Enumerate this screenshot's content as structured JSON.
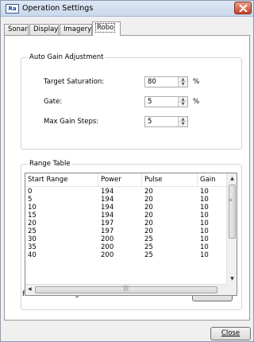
{
  "window": {
    "app_icon_text": "Ra",
    "title": "Operation Settings",
    "close_icon": "close-icon"
  },
  "tabs": [
    {
      "label": "Sonar"
    },
    {
      "label": "Display"
    },
    {
      "label": "Imagery"
    },
    {
      "label": "Robo",
      "active": true
    }
  ],
  "auto_gain": {
    "group_title": "Auto Gain Adjustment",
    "fields": [
      {
        "label": "Target Saturation:",
        "value": "80",
        "unit": "%"
      },
      {
        "label": "Gate:",
        "value": "5",
        "unit": "%"
      },
      {
        "label": "Max Gain Steps:",
        "value": "5",
        "unit": ""
      }
    ]
  },
  "range_table": {
    "group_title": "Range Table",
    "columns": [
      "Start Range",
      "Power",
      "Pulse",
      "Gain"
    ],
    "rows": [
      [
        "0",
        "194",
        "20",
        "10"
      ],
      [
        "5",
        "194",
        "20",
        "10"
      ],
      [
        "10",
        "194",
        "20",
        "10"
      ],
      [
        "15",
        "194",
        "20",
        "10"
      ],
      [
        "20",
        "197",
        "20",
        "10"
      ],
      [
        "25",
        "197",
        "20",
        "10"
      ],
      [
        "30",
        "200",
        "25",
        "10"
      ],
      [
        "35",
        "200",
        "25",
        "10"
      ],
      [
        "40",
        "200",
        "25",
        "10"
      ]
    ],
    "file_label": "File: RoboSettingsTable.ini",
    "view_button": "View..."
  },
  "footer": {
    "close_button": "Close"
  },
  "colors": {
    "accent": "#3a5a9a",
    "close_red": "#c7432a"
  }
}
